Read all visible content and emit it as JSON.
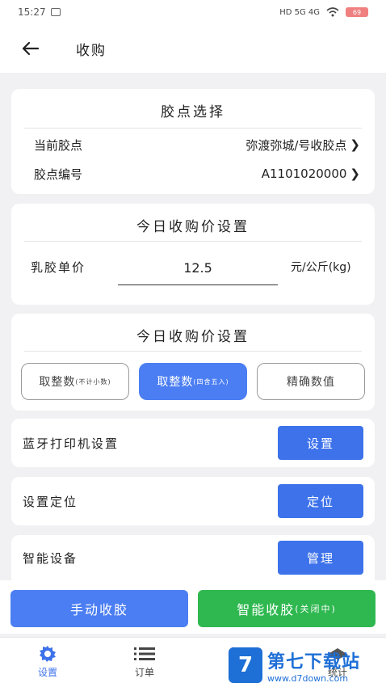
{
  "status_bar": {
    "time": "15:27",
    "signal": "HD 5G 4G",
    "battery": "69"
  },
  "header": {
    "title": "收购"
  },
  "station_card": {
    "title": "胶点选择",
    "current_label": "当前胶点",
    "current_value": "弥渡弥城/号收胶点",
    "code_label": "胶点编号",
    "code_value": "A1101020000"
  },
  "price_card": {
    "title": "今日收购价设置",
    "latex_label": "乳胶单价",
    "price_value": "12.5",
    "unit": "元/公斤(kg)"
  },
  "rounding_card": {
    "title": "今日收购价设置",
    "options": [
      {
        "main": "取整数",
        "note": "(不计小数)"
      },
      {
        "main": "取整数",
        "note": "(四舍五入)"
      },
      {
        "main": "精确数值",
        "note": ""
      }
    ]
  },
  "printer": {
    "label": "蓝牙打印机设置",
    "button": "设置"
  },
  "location": {
    "label": "设置定位",
    "button": "定位"
  },
  "smart_device": {
    "label": "智能设备",
    "button": "管理"
  },
  "actions": {
    "manual": "手动收胶",
    "smart": "智能收胶",
    "smart_note": "(关闭中)"
  },
  "tabs": [
    {
      "label": "设置",
      "icon": "gear-icon"
    },
    {
      "label": "订单",
      "icon": "list-icon"
    },
    {
      "label": "",
      "icon": "bar-icon"
    },
    {
      "label": "统计",
      "icon": "chart-icon"
    }
  ],
  "watermark": {
    "logo": "7",
    "name": "第七下载站",
    "url": "www.d7down.com"
  },
  "colors": {
    "primary": "#3d72ea",
    "green": "#2fb850",
    "bg": "#f1f1f3"
  }
}
